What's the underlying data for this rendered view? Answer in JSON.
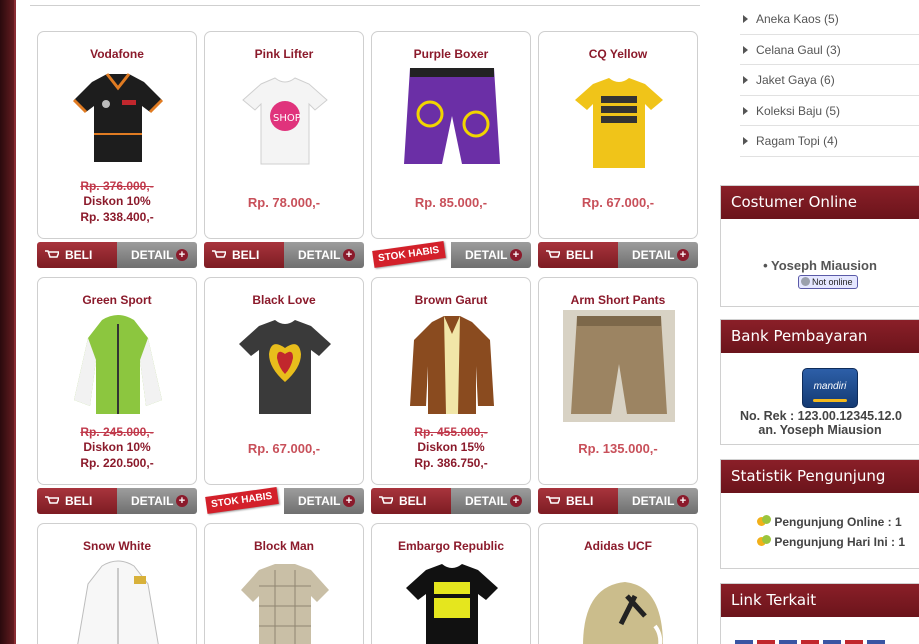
{
  "products": [
    {
      "name": "Vodafone",
      "price_old": "Rp. 376.000,-",
      "discount": "Diskon 10%",
      "price_new": "Rp. 338.400,-",
      "img": "shirt-icon",
      "stock": "in"
    },
    {
      "name": "Pink Lifter",
      "price": "Rp. 78.000,-",
      "img": "tshirt-icon",
      "stock": "in"
    },
    {
      "name": "Purple Boxer",
      "price": "Rp. 85.000,-",
      "img": "shorts-icon",
      "stock": "out"
    },
    {
      "name": "CQ Yellow",
      "price": "Rp. 67.000,-",
      "img": "tshirt-icon",
      "stock": "in"
    },
    {
      "name": "Green Sport",
      "price_old": "Rp. 245.000,-",
      "discount": "Diskon 10%",
      "price_new": "Rp. 220.500,-",
      "img": "jacket-icon",
      "stock": "out"
    },
    {
      "name": "Black Love",
      "price": "Rp. 67.000,-",
      "img": "tshirt-icon",
      "stock": "out"
    },
    {
      "name": "Brown Garut",
      "price_old": "Rp. 455.000,-",
      "discount": "Diskon 15%",
      "price_new": "Rp. 386.750,-",
      "img": "jacket-icon",
      "stock": "in"
    },
    {
      "name": "Arm Short Pants",
      "price": "Rp. 135.000,-",
      "img": "shorts-icon",
      "stock": "in"
    },
    {
      "name": "Snow White",
      "img": "jacket-icon"
    },
    {
      "name": "Block Man",
      "img": "shirt-icon"
    },
    {
      "name": "Embargo Republic",
      "img": "tshirt-icon"
    },
    {
      "name": "Adidas UCF",
      "img": "cap-icon"
    }
  ],
  "buttons": {
    "beli": "BELI",
    "detail": "DETAIL",
    "plus": "+",
    "stok_habis": "STOK HABIS"
  },
  "categories": [
    "Aneka Kaos (5)",
    "Celana Gaul (3)",
    "Jaket Gaya (6)",
    "Koleksi Baju (5)",
    "Ragam Topi (4)"
  ],
  "customer_online": {
    "title": "Costumer Online",
    "user": "• Yoseph Miausion",
    "status": "Not online"
  },
  "bank": {
    "title": "Bank Pembayaran",
    "logo": "mandiri",
    "rek": "No. Rek : 123.00.12345.12.0",
    "an": "an. Yoseph Miausion"
  },
  "stats": {
    "title": "Statistik Pengunjung",
    "online": "Pengunjung Online : 1",
    "today": "Pengunjung Hari Ini : 1"
  },
  "link": {
    "title": "Link Terkait"
  },
  "colors": {
    "accent": "#8b1a2b",
    "price": "#c8505a",
    "header": "#7a1a21"
  }
}
